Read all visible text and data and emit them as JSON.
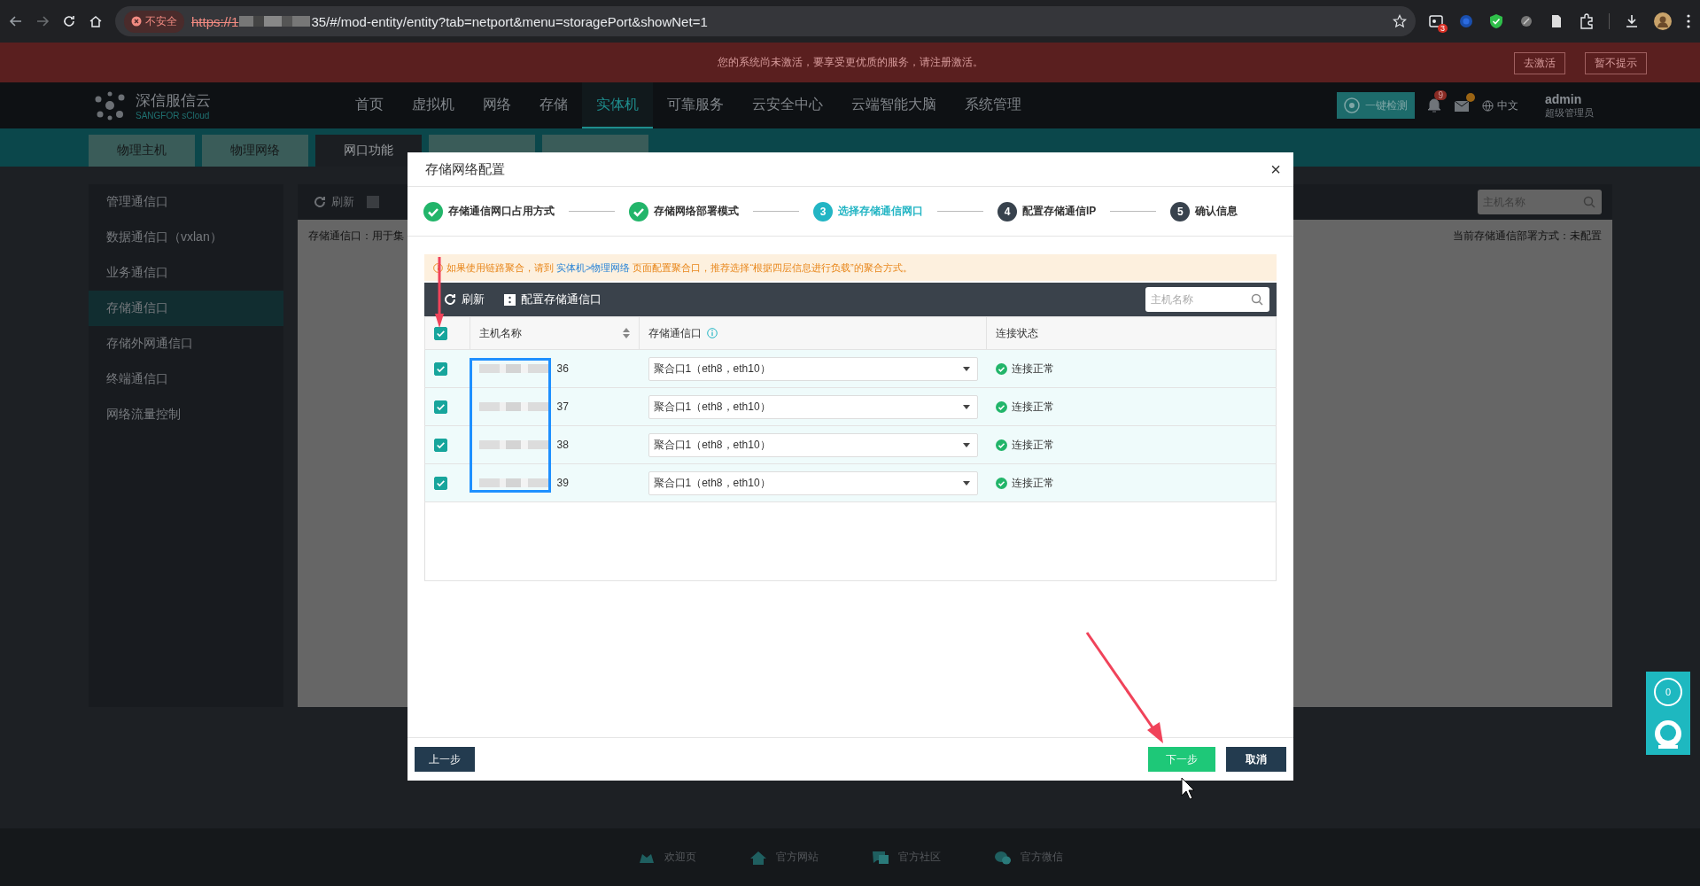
{
  "browser": {
    "security_label": "不安全",
    "url_start": "https://1",
    "url_end": "35/#/mod-entity/entity?tab=netport&menu=storagePort&showNet=1",
    "extension_badge": "3"
  },
  "banner": {
    "message": "您的系统尚未激活，要享受更优质的服务，请注册激活。",
    "buttons": [
      "去激活",
      "暂不提示"
    ]
  },
  "header": {
    "logo_name": "深信服信云",
    "logo_sub": "SANGFOR sCloud",
    "nav": [
      {
        "label": "首页",
        "selected": false
      },
      {
        "label": "虚拟机",
        "selected": false
      },
      {
        "label": "网络",
        "selected": false
      },
      {
        "label": "存储",
        "selected": false
      },
      {
        "label": "实体机",
        "selected": true
      },
      {
        "label": "可靠服务",
        "selected": false
      },
      {
        "label": "云安全中心",
        "selected": false
      },
      {
        "label": "云端智能大脑",
        "selected": false
      },
      {
        "label": "系统管理",
        "selected": false
      }
    ],
    "check_button": "一键检测",
    "notification_count": "9",
    "language": "中文",
    "user_name": "admin",
    "user_role": "超级管理员"
  },
  "tabs": [
    {
      "label": "物理主机",
      "selected": false
    },
    {
      "label": "物理网络",
      "selected": false
    },
    {
      "label": "网口功能",
      "selected": true
    },
    {
      "selected": false
    },
    {
      "selected": false
    }
  ],
  "sidebar": [
    {
      "label": "管理通信口",
      "selected": false
    },
    {
      "label": "数据通信口（vxlan）",
      "selected": false
    },
    {
      "label": "业务通信口",
      "selected": false
    },
    {
      "label": "存储通信口",
      "selected": true
    },
    {
      "label": "存储外网通信口",
      "selected": false
    },
    {
      "label": "终端通信口",
      "selected": false
    },
    {
      "label": "网络流量控制",
      "selected": false
    }
  ],
  "content": {
    "refresh": "刷新",
    "description": "存储通信口：用于集",
    "search_placeholder": "主机名称",
    "deploy_status": "当前存储通信部署方式：未配置"
  },
  "modal": {
    "title": "存储网络配置",
    "close": "×",
    "steps": [
      {
        "label": "存储通信网口占用方式",
        "done": true,
        "selected": false
      },
      {
        "label": "存储网络部署模式",
        "done": true,
        "selected": false
      },
      {
        "number": "3",
        "label": "选择存储通信网口",
        "done": false,
        "selected": true
      },
      {
        "number": "4",
        "label": "配置存储通信IP",
        "done": false,
        "selected": false
      },
      {
        "number": "5",
        "label": "确认信息",
        "done": false,
        "selected": false
      }
    ],
    "alert": {
      "before": "如果使用链路聚合，请到",
      "link": "实体机>物理网络",
      "after": "页面配置聚合口，推荐选择“根据四层信息进行负载”的聚合方式。"
    },
    "toolbar": {
      "refresh": "刷新",
      "configure": "配置存储通信口",
      "search_placeholder": "主机名称"
    },
    "table": {
      "select_all_checked": true,
      "columns": [
        "主机名称",
        "存储通信口",
        "连接状态"
      ],
      "rows": [
        {
          "host_end": "36",
          "checked": true,
          "port": "聚合口1（eth8，eth10）",
          "status": "连接正常"
        },
        {
          "host_end": "37",
          "checked": true,
          "port": "聚合口1（eth8，eth10）",
          "status": "连接正常"
        },
        {
          "host_end": "38",
          "checked": true,
          "port": "聚合口1（eth8，eth10）",
          "status": "连接正常"
        },
        {
          "host_end": "39",
          "checked": true,
          "port": "聚合口1（eth8，eth10）",
          "status": "连接正常"
        }
      ]
    },
    "buttons": {
      "prev": "上一步",
      "next": "下一步",
      "cancel": "取消"
    }
  },
  "footer_links": [
    "欢迎页",
    "官方网站",
    "官方社区",
    "官方微信"
  ],
  "side_widget": {
    "count": "0"
  }
}
